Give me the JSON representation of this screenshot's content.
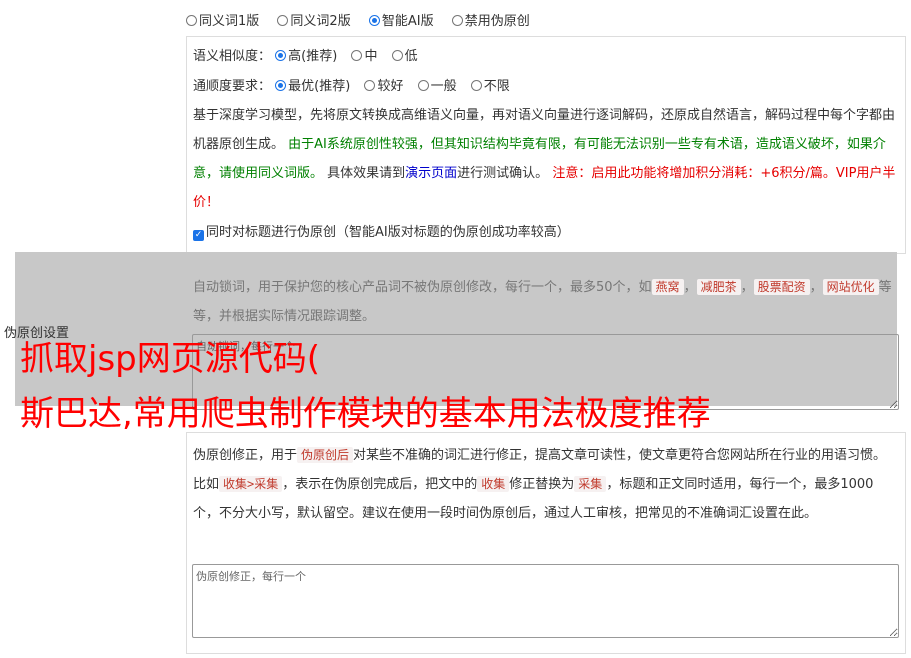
{
  "top_options": [
    {
      "label": "同义词1版",
      "checked": false
    },
    {
      "label": "同义词2版",
      "checked": false
    },
    {
      "label": "智能AI版",
      "checked": true
    },
    {
      "label": "禁用伪原创",
      "checked": false
    }
  ],
  "similarity": {
    "label": "语义相似度：",
    "options": [
      {
        "label": "高(推荐)",
        "checked": true
      },
      {
        "label": "中",
        "checked": false
      },
      {
        "label": "低",
        "checked": false
      }
    ]
  },
  "fluency": {
    "label": "通顺度要求：",
    "options": [
      {
        "label": "最优(推荐)",
        "checked": true
      },
      {
        "label": "较好",
        "checked": false
      },
      {
        "label": "一般",
        "checked": false
      },
      {
        "label": "不限",
        "checked": false
      }
    ]
  },
  "description": {
    "normal1": "基于深度学习模型，先将原文转换成高维语义向量，再对语义向量进行逐词解码，还原成自然语言，解码过程中每个字都由机器原创生成。 ",
    "green": "由于AI系统原创性较强，但其知识结构毕竟有限，有可能无法识别一些专有术语，造成语义破坏，如果介意，请使用同义词版。",
    "normal2": " 具体效果请到",
    "link": "演示页面",
    "normal3": "进行测试确认。 ",
    "red": "注意：启用此功能将增加积分消耗：+6积分/篇。VIP用户半价！"
  },
  "title_checkbox": {
    "label": "同时对标题进行伪原创（智能AI版对标题的伪原创成功率较高）",
    "checked": true
  },
  "lock_words": {
    "text1": "自动锁词，用于保护您的核心产品词不被伪原创修改，每行一个，最多50个，如",
    "tags": [
      "燕窝",
      "减肥茶",
      "股票配资",
      "网站优化"
    ],
    "text2": "等等，并根据实际情况跟踪调整。",
    "placeholder": "自动锁词，每行一个"
  },
  "section_label": "伪原创设置",
  "correction": {
    "t1": "伪原创修正，用于",
    "tag1": "伪原创后",
    "t2": "对某些不准确的词汇进行修正，提高文章可读性，使文章更符合您网站所在行业的用语习惯。比如",
    "tag2": "收集>采集",
    "t3": "，表示在伪原创完成后，把文中的",
    "tag3": "收集",
    "t4": "修正替换为",
    "tag4": "采集",
    "t5": "，标题和正文同时适用，每行一个，最多1000个，不分大小写，默认留空。建议在使用一段时间伪原创后，通过人工审核，把常见的不准确词汇设置在此。",
    "placeholder": "伪原创修正，每行一个"
  },
  "headline": {
    "line1": "抓取jsp网页源代码(",
    "line2": "斯巴达,常用爬虫制作模块的基本用法极度推荐"
  }
}
